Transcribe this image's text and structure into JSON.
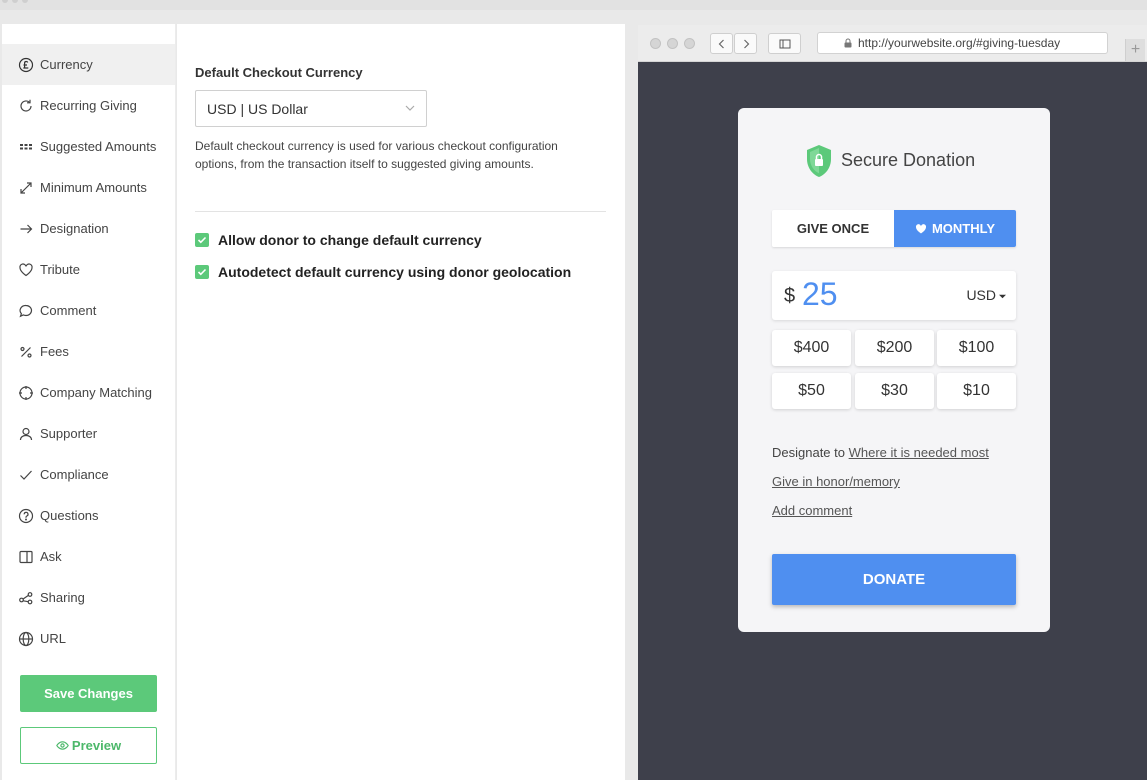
{
  "nav": {
    "items": [
      {
        "label": "Currency",
        "icon": "pound-circle-icon",
        "active": true
      },
      {
        "label": "Recurring Giving",
        "icon": "refresh-icon"
      },
      {
        "label": "Suggested Amounts",
        "icon": "grid-icon"
      },
      {
        "label": "Minimum Amounts",
        "icon": "expand-icon"
      },
      {
        "label": "Designation",
        "icon": "arrow-right-icon"
      },
      {
        "label": "Tribute",
        "icon": "heart-icon"
      },
      {
        "label": "Comment",
        "icon": "comment-icon"
      },
      {
        "label": "Fees",
        "icon": "percent-icon"
      },
      {
        "label": "Company Matching",
        "icon": "crosshair-icon"
      },
      {
        "label": "Supporter",
        "icon": "user-icon"
      },
      {
        "label": "Compliance",
        "icon": "check-icon"
      },
      {
        "label": "Questions",
        "icon": "question-icon"
      },
      {
        "label": "Ask",
        "icon": "panel-icon"
      },
      {
        "label": "Sharing",
        "icon": "share-icon"
      },
      {
        "label": "URL",
        "icon": "globe-icon"
      }
    ],
    "save_label": "Save Changes",
    "preview_label": "Preview"
  },
  "settings": {
    "field_label": "Default Checkout Currency",
    "select_value": "USD | US Dollar",
    "help_text": "Default checkout currency is used for various checkout configuration options, from the transaction itself to suggested giving amounts.",
    "checkboxes": [
      {
        "label": "Allow donor to change default currency",
        "checked": true
      },
      {
        "label": "Autodetect default currency using donor geolocation",
        "checked": true
      }
    ]
  },
  "browser": {
    "url": "http://yourwebsite.org/#giving-tuesday",
    "new_tab": "+"
  },
  "card": {
    "title": "Secure Donation",
    "give_once": "GIVE ONCE",
    "monthly": "MONTHLY",
    "currency_symbol": "$",
    "amount": "25",
    "currency": "USD",
    "amounts": [
      "$400",
      "$200",
      "$100",
      "$50",
      "$30",
      "$10"
    ],
    "designate_prefix": "Designate to",
    "designate_link": "Where it is needed most",
    "honor_link": "Give in honor/memory",
    "comment_link": "Add comment",
    "donate_label": "DONATE"
  },
  "colors": {
    "accent_green": "#5cc97a",
    "accent_blue": "#4f8ff0",
    "preview_bg": "#3e404b"
  }
}
